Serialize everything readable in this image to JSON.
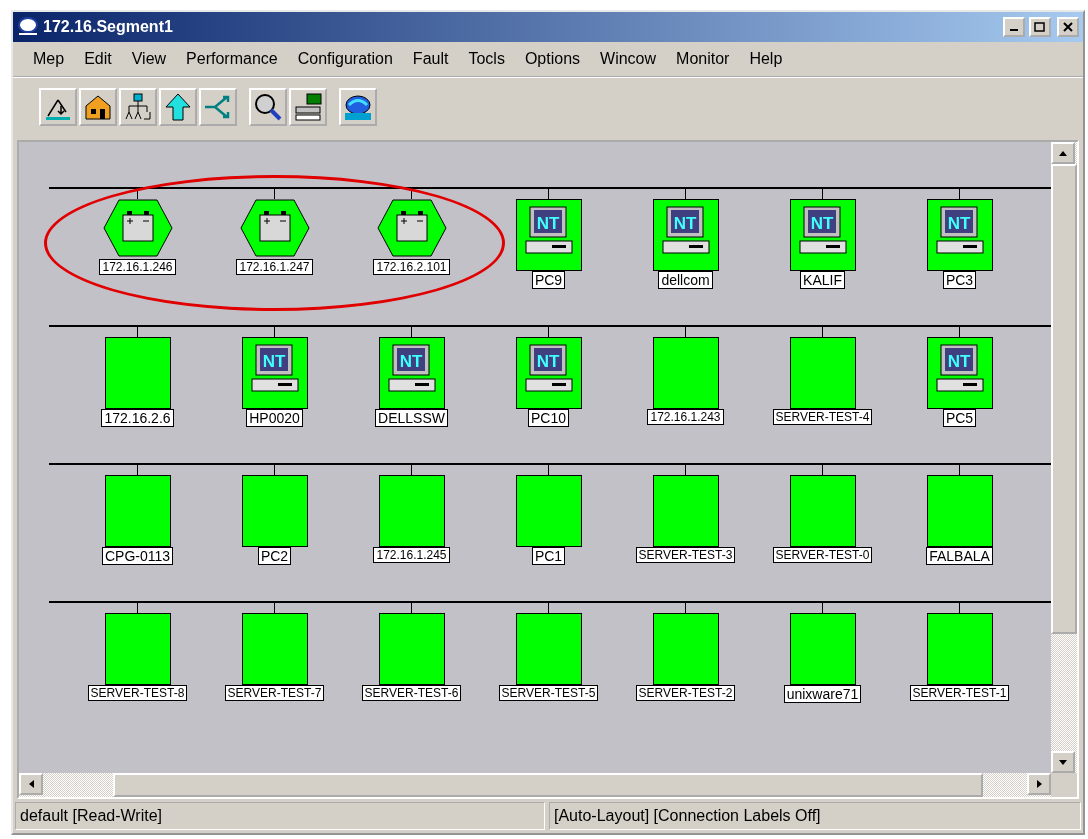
{
  "window": {
    "title": "172.16.Segment1"
  },
  "menu": [
    "Mep",
    "Edit",
    "View",
    "Performance",
    "Configuration",
    "Fault",
    "Tocls",
    "Options",
    "Wincow",
    "Monitor",
    "Help"
  ],
  "toolbar": [
    [
      {
        "kind": "draw"
      },
      {
        "kind": "home"
      },
      {
        "kind": "tree"
      },
      {
        "kind": "up"
      },
      {
        "kind": "arrows"
      }
    ],
    [
      {
        "kind": "search"
      },
      {
        "kind": "device"
      }
    ],
    [
      {
        "kind": "logo"
      }
    ]
  ],
  "segments": [
    {
      "circled_nodes": [
        {
          "kind": "battery",
          "label": "172.16.1.246"
        },
        {
          "kind": "battery",
          "label": "172.16.1.247"
        },
        {
          "kind": "battery",
          "label": "172.16.2.101"
        }
      ],
      "nodes": [
        {
          "kind": "nt",
          "badge": "NT",
          "label": "PC9"
        },
        {
          "kind": "nt",
          "badge": "NT",
          "label": "dellcom"
        },
        {
          "kind": "nt",
          "badge": "NT",
          "label": "KALIF"
        },
        {
          "kind": "nt",
          "badge": "NT",
          "label": "PC3"
        }
      ]
    },
    {
      "nodes": [
        {
          "kind": "plain",
          "label": "172.16.2.6"
        },
        {
          "kind": "nt",
          "badge": "NT",
          "label": "HP0020"
        },
        {
          "kind": "nt",
          "badge": "NT",
          "label": "DELLSSW"
        },
        {
          "kind": "nt",
          "badge": "NT",
          "label": "PC10"
        },
        {
          "kind": "plain",
          "label": "172.16.1.243"
        },
        {
          "kind": "plain",
          "label": "SERVER-TEST-4"
        },
        {
          "kind": "nt",
          "badge": "NT",
          "label": "PC5"
        }
      ]
    },
    {
      "nodes": [
        {
          "kind": "plain",
          "label": "CPG-0113"
        },
        {
          "kind": "plain",
          "label": "PC2"
        },
        {
          "kind": "plain",
          "label": "172.16.1.245"
        },
        {
          "kind": "plain",
          "label": "PC1"
        },
        {
          "kind": "plain",
          "label": "SERVER-TEST-3"
        },
        {
          "kind": "plain",
          "label": "SERVER-TEST-0"
        },
        {
          "kind": "plain",
          "label": "FALBALA"
        }
      ]
    },
    {
      "nodes": [
        {
          "kind": "plain",
          "label": "SERVER-TEST-8"
        },
        {
          "kind": "plain",
          "label": "SERVER-TEST-7"
        },
        {
          "kind": "plain",
          "label": "SERVER-TEST-6"
        },
        {
          "kind": "plain",
          "label": "SERVER-TEST-5"
        },
        {
          "kind": "plain",
          "label": "SERVER-TEST-2"
        },
        {
          "kind": "plain",
          "label": "unixware71"
        },
        {
          "kind": "plain",
          "label": "SERVER-TEST-1"
        }
      ]
    }
  ],
  "status_bar": [
    "default [Read-Write]",
    "[Auto-Layout] [Connection Labels Off]"
  ]
}
